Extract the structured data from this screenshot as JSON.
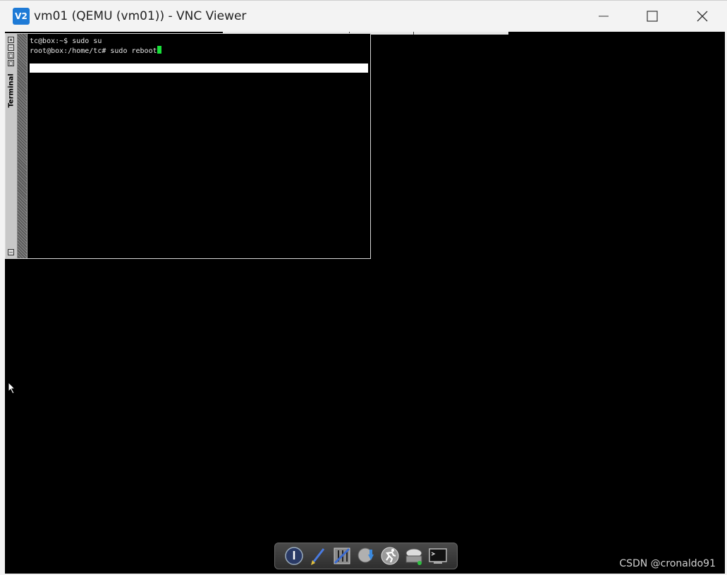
{
  "window": {
    "icon_label": "V2",
    "title": "vm01 (QEMU (vm01)) - VNC Viewer"
  },
  "terminal": {
    "title": "Terminal",
    "lines": [
      "tc@box:~$ sudo su",
      "root@box:/home/tc# sudo reboot"
    ]
  },
  "dock": {
    "icons": [
      "power-icon",
      "brush-icon",
      "control-panel-icon",
      "apps-install-icon",
      "run-icon",
      "mount-drive-icon",
      "terminal-icon"
    ]
  },
  "watermark": "CSDN @cronaldo91",
  "colors": {
    "cursor": "#19e03a",
    "app_icon": "#1e7ad6"
  }
}
